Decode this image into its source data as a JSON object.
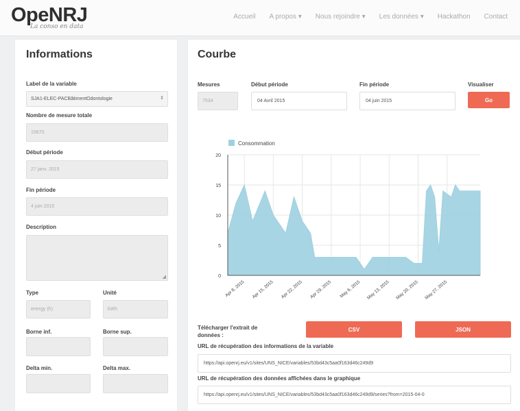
{
  "header": {
    "logo": "OpeNRJ",
    "logo_sub": "La conso en data",
    "nav": [
      "Accueil",
      "A propos ▾",
      "Nous rejoindre ▾",
      "Les données ▾",
      "Hackathon",
      "Contact"
    ]
  },
  "info": {
    "title": "Informations",
    "label_variable": "Label de la variable",
    "variable_value": "SJA1-ELEC-PACBâtimentOdontologie",
    "nb_mesure_label": "Nombre de mesure totale",
    "nb_mesure_value": "15670",
    "debut_label": "Début période",
    "debut_value": "27 janv. 2015",
    "fin_label": "Fin période",
    "fin_value": "4 juin 2015",
    "description_label": "Description",
    "type_label": "Type",
    "type_value": "energy (h)",
    "unite_label": "Unité",
    "unite_value": "kWh",
    "borne_inf_label": "Borne inf.",
    "borne_sup_label": "Borne sup.",
    "delta_min_label": "Delta min.",
    "delta_max_label": "Delta max."
  },
  "courbe": {
    "title": "Courbe",
    "mesures_label": "Mesures",
    "mesures_value": "7534",
    "debut_label": "Début période",
    "debut_value": "04 Avril 2015",
    "fin_label": "Fin période",
    "fin_value": "04 juin 2015",
    "visualiser_label": "Visualiser",
    "go_label": "Go",
    "download_label_1": "Télécharger l'extrait de",
    "download_label_2": "données :",
    "csv_label": "CSV",
    "json_label": "JSON",
    "url_info_label": "URL de récupération des informations de la variable",
    "url_info_value": "https://api.openrj.eu/v1/sites/UNS_NICE/variables/53bd43c5aa0f163d46c249d9",
    "url_data_label": "URL de récupération des données affichées dans le graphique",
    "url_data_value": "https://api.openrj.eu/v1/sites/UNS_NICE/variables/53bd43c5aa0f163d46c249d9/series?from=2015-04-0"
  },
  "colors": {
    "accent": "#ef6a55",
    "series": "#9fd0e0"
  },
  "chart_data": {
    "type": "area",
    "legend": [
      "Consommation"
    ],
    "legend_position": "top-left",
    "grid": true,
    "ylim": [
      0,
      20
    ],
    "yticks": [
      0,
      5,
      10,
      15,
      20
    ],
    "xlim": [
      "2015-04-04",
      "2015-06-04"
    ],
    "xticks": [
      "Apr 8, 2015",
      "Apr 15, 2015",
      "Apr 22, 2015",
      "Apr 29, 2015",
      "May 6, 2015",
      "May 13, 2015",
      "May 20, 2015",
      "May 27, 2015"
    ],
    "series": [
      {
        "name": "Consommation",
        "points": [
          [
            "2015-04-04",
            7
          ],
          [
            "2015-04-06",
            12
          ],
          [
            "2015-04-08",
            15
          ],
          [
            "2015-04-10",
            9
          ],
          [
            "2015-04-13",
            14
          ],
          [
            "2015-04-15",
            10
          ],
          [
            "2015-04-18",
            7
          ],
          [
            "2015-04-20",
            13
          ],
          [
            "2015-04-22",
            9
          ],
          [
            "2015-04-24",
            7
          ],
          [
            "2015-04-25",
            3
          ],
          [
            "2015-04-27",
            3
          ],
          [
            "2015-04-29",
            3
          ],
          [
            "2015-05-01",
            3
          ],
          [
            "2015-05-03",
            3
          ],
          [
            "2015-05-05",
            3
          ],
          [
            "2015-05-07",
            1
          ],
          [
            "2015-05-09",
            3
          ],
          [
            "2015-05-11",
            3
          ],
          [
            "2015-05-13",
            3
          ],
          [
            "2015-05-15",
            3
          ],
          [
            "2015-05-17",
            3
          ],
          [
            "2015-05-19",
            2
          ],
          [
            "2015-05-21",
            2
          ],
          [
            "2015-05-22",
            14
          ],
          [
            "2015-05-23",
            15
          ],
          [
            "2015-05-24",
            13
          ],
          [
            "2015-05-25",
            4
          ],
          [
            "2015-05-26",
            14
          ],
          [
            "2015-05-28",
            13
          ],
          [
            "2015-05-29",
            15
          ],
          [
            "2015-05-30",
            14
          ],
          [
            "2015-06-01",
            14
          ],
          [
            "2015-06-04",
            14
          ]
        ]
      }
    ]
  }
}
